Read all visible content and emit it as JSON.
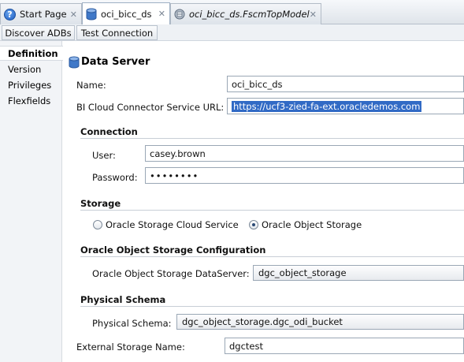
{
  "tabs": [
    {
      "label": "Start Page",
      "icon": "help-icon"
    },
    {
      "label": "oci_bicc_ds",
      "icon": "database-icon",
      "active": true
    },
    {
      "label": "oci_bicc_ds.FscmTopModel",
      "icon": "model-icon"
    }
  ],
  "toolbar": {
    "discover_label": "Discover ADBs",
    "test_connection_label": "Test Connection"
  },
  "nav": [
    "Definition",
    "Version",
    "Privileges",
    "Flexfields"
  ],
  "form": {
    "title": "Data Server",
    "name_label": "Name:",
    "name_value": "oci_bicc_ds",
    "url_label": "BI Cloud Connector Service URL:",
    "url_value": "https://ucf3-zied-fa-ext.oracledemos.com",
    "connection": {
      "heading": "Connection",
      "user_label": "User:",
      "user_value": "casey.brown",
      "password_label": "Password:",
      "password_value": "••••••••"
    },
    "storage": {
      "heading": "Storage",
      "option_cloud": "Oracle Storage Cloud Service",
      "option_object": "Oracle Object Storage",
      "selected": "Oracle Object Storage"
    },
    "object_storage": {
      "heading": "Oracle Object Storage Configuration",
      "dataserver_label": "Oracle Object Storage DataServer:",
      "dataserver_value": "dgc_object_storage"
    },
    "physical_schema": {
      "heading": "Physical Schema",
      "label": "Physical Schema:",
      "value": "dgc_object_storage.dgc_odi_bucket"
    },
    "external_storage": {
      "label": "External Storage Name:",
      "value": "dgctest"
    }
  }
}
